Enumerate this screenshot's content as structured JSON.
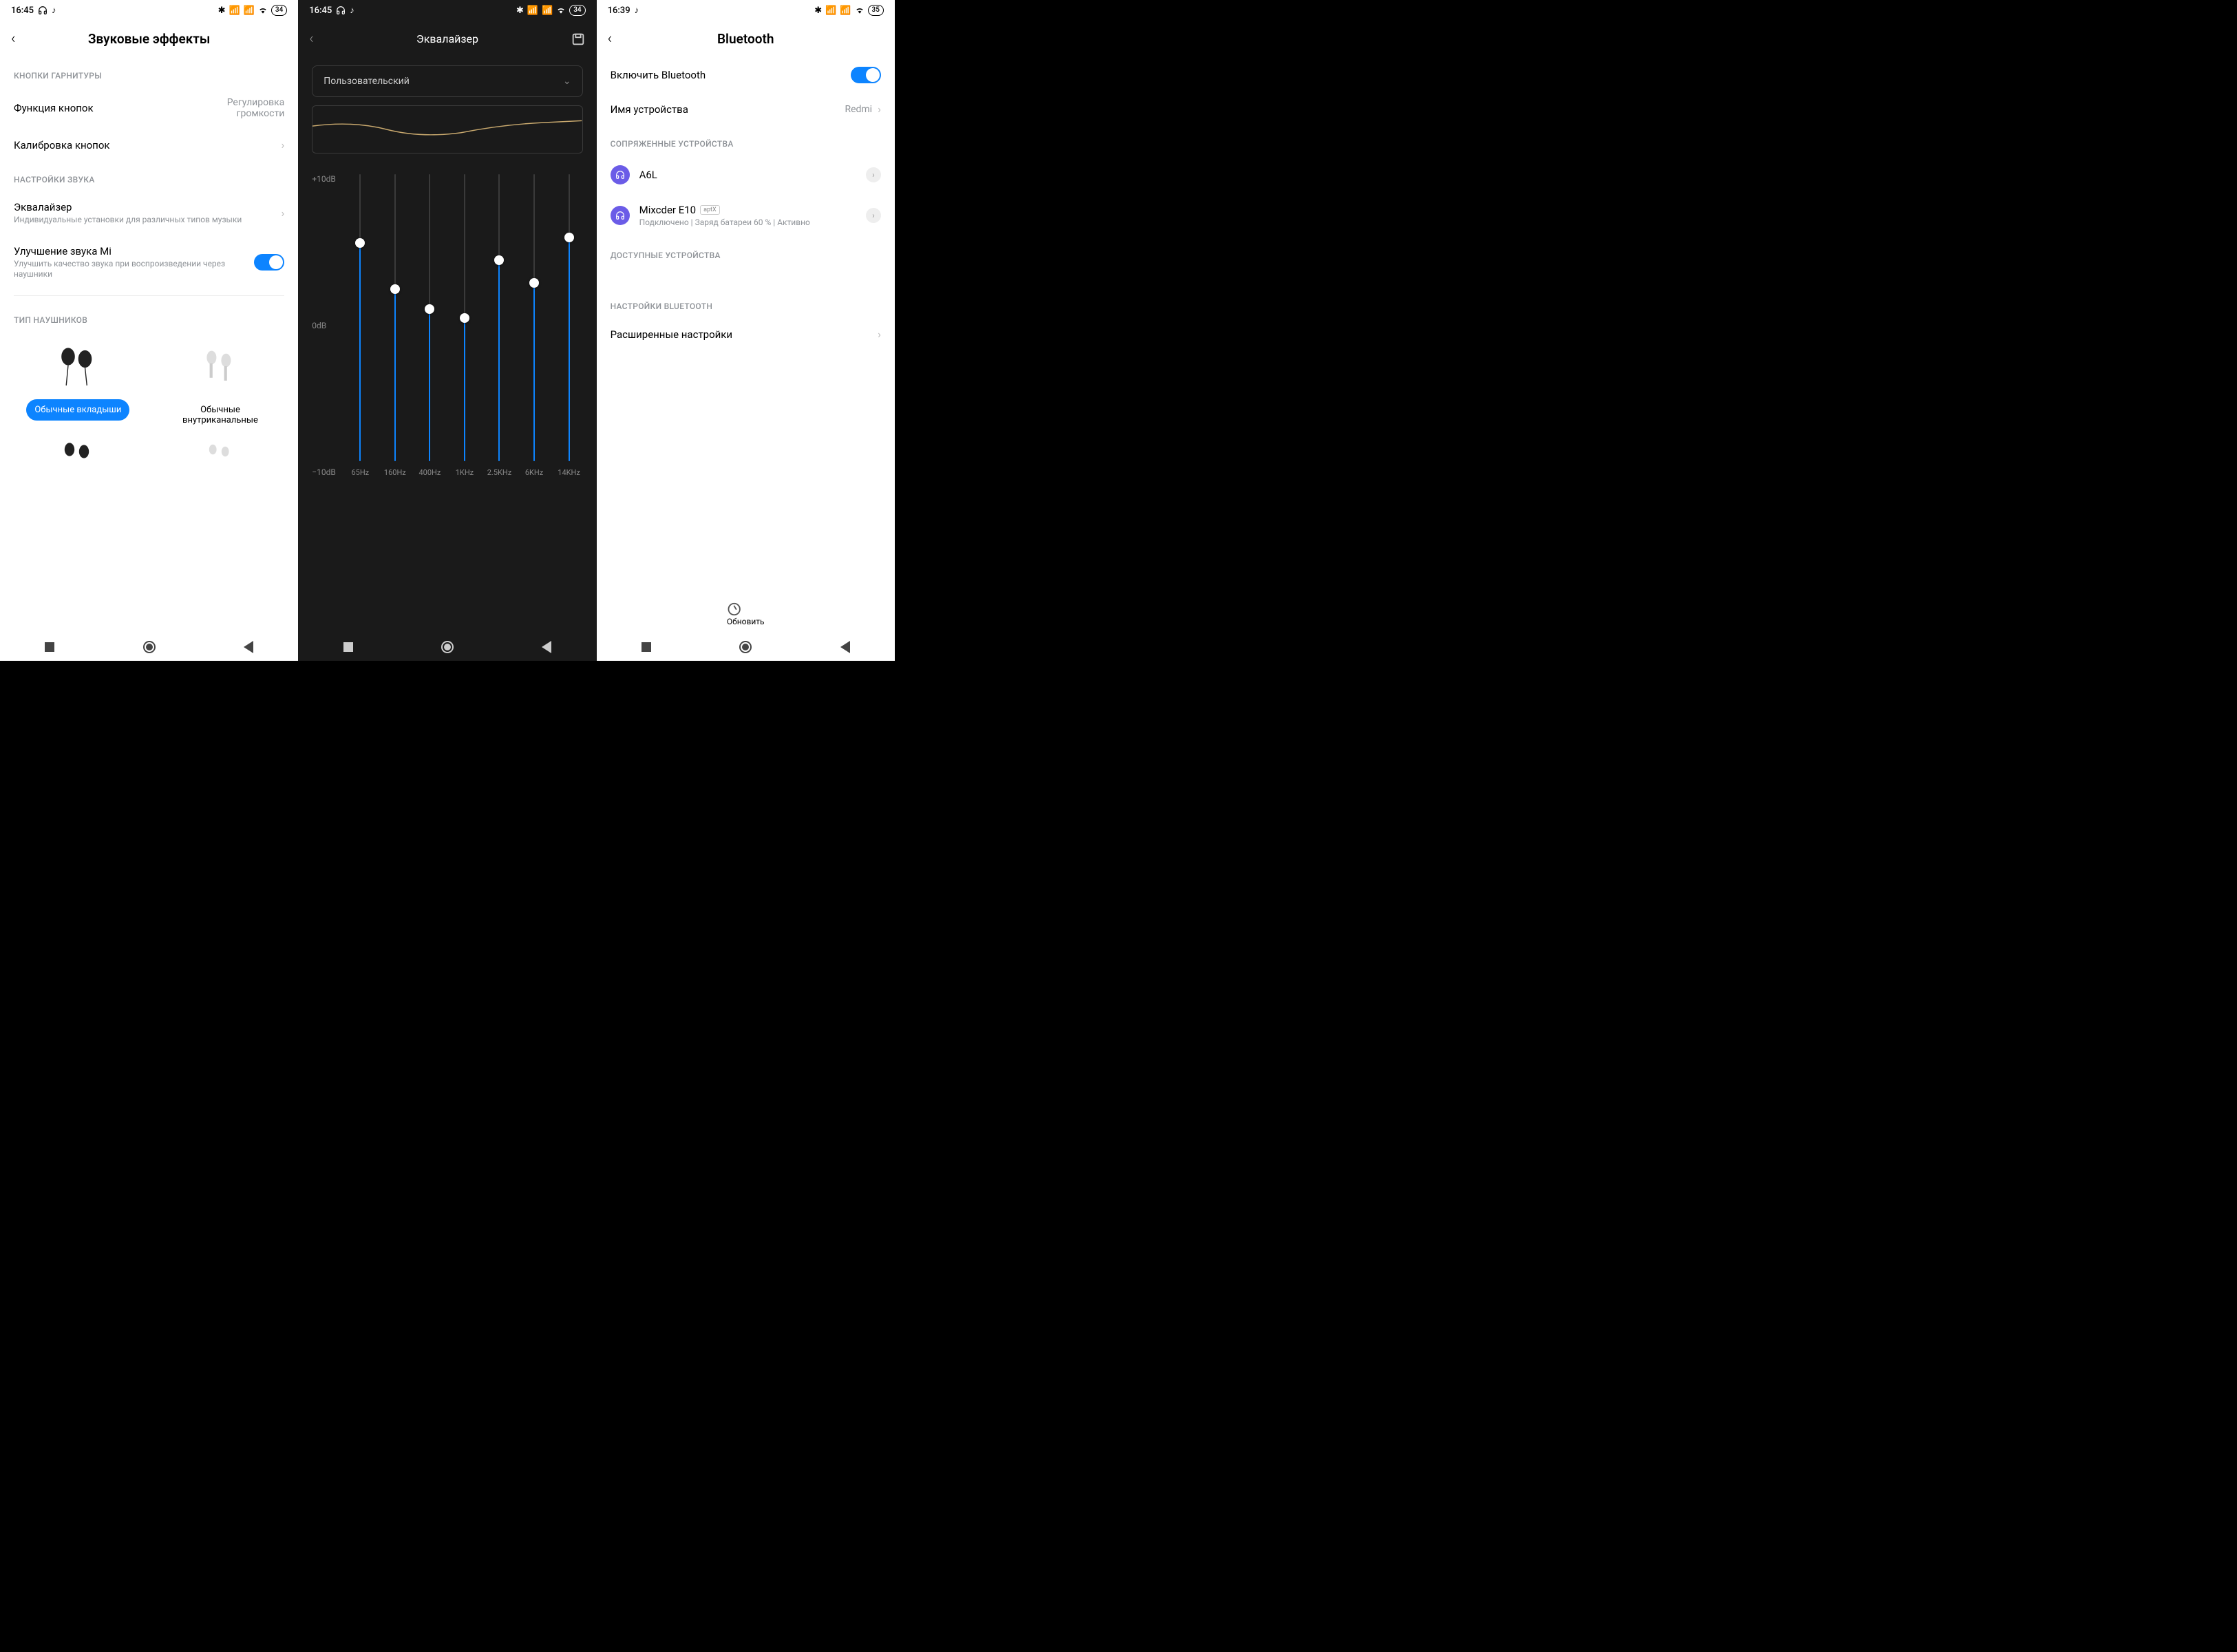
{
  "screen1": {
    "status": {
      "time": "16:45",
      "battery": "34"
    },
    "title": "Звуковые эффекты",
    "sections": {
      "headset_buttons": "КНОПКИ ГАРНИТУРЫ",
      "sound_settings": "НАСТРОЙКИ ЗВУКА",
      "headphone_type": "ТИП НАУШНИКОВ"
    },
    "items": {
      "button_func": {
        "title": "Функция кнопок",
        "value": "Регулировка громкости"
      },
      "calibration": {
        "title": "Калибровка кнопок"
      },
      "equalizer": {
        "title": "Эквалайзер",
        "sub": "Индивидуальные установки для различных типов музыки"
      },
      "mi_sound": {
        "title": "Улучшение звука Mi",
        "sub": "Улучшить качество звука при воспроизведении через наушники"
      }
    },
    "headphones": {
      "earbuds": "Обычные вкладыши",
      "inear": "Обычные внутриканальные"
    }
  },
  "screen2": {
    "status": {
      "time": "16:45",
      "battery": "34"
    },
    "title": "Эквалайзер",
    "preset": "Пользовательский",
    "y_labels": {
      "top": "+10dB",
      "mid": "0dB",
      "bot": "−10dB"
    },
    "bands": [
      {
        "freq": "65Hz",
        "pct": 76
      },
      {
        "freq": "160Hz",
        "pct": 60
      },
      {
        "freq": "400Hz",
        "pct": 53
      },
      {
        "freq": "1KHz",
        "pct": 50
      },
      {
        "freq": "2.5KHz",
        "pct": 70
      },
      {
        "freq": "6KHz",
        "pct": 62
      },
      {
        "freq": "14KHz",
        "pct": 78
      }
    ]
  },
  "screen3": {
    "status": {
      "time": "16:39",
      "battery": "35"
    },
    "title": "Bluetooth",
    "enable": "Включить Bluetooth",
    "device_name": {
      "label": "Имя устройства",
      "value": "Redmi"
    },
    "sections": {
      "paired": "СОПРЯЖЕННЫЕ УСТРОЙСТВА",
      "available": "ДОСТУПНЫЕ УСТРОЙСТВА",
      "settings": "НАСТРОЙКИ BLUETOOTH"
    },
    "devices": {
      "a6l": {
        "name": "A6L"
      },
      "mixcder": {
        "name": "Mixcder E10",
        "badge": "aptX",
        "status": "Подключено | Заряд батареи 60 % | Активно"
      }
    },
    "advanced": "Расширенные настройки",
    "refresh": "Обновить"
  },
  "chart_data": {
    "type": "bar",
    "title": "Эквалайзер",
    "categories": [
      "65Hz",
      "160Hz",
      "400Hz",
      "1KHz",
      "2.5KHz",
      "6KHz",
      "14KHz"
    ],
    "values": [
      5.2,
      2.0,
      0.6,
      0.0,
      4.0,
      2.4,
      5.6
    ],
    "ylabel": "dB",
    "ylim": [
      -10,
      10
    ]
  }
}
